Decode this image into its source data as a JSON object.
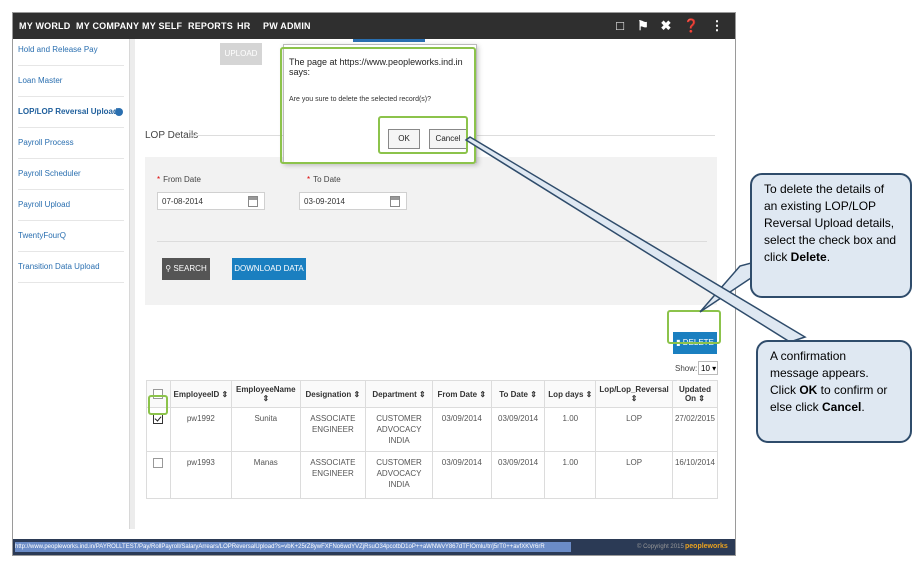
{
  "nav": {
    "items": [
      "MY WORLD",
      "MY COMPANY",
      "MY SELF",
      "REPORTS",
      "HR",
      "PW ADMIN"
    ],
    "icons": [
      "book-icon",
      "flag-icon",
      "tools-icon",
      "help-icon",
      "share-icon"
    ]
  },
  "sidebar": {
    "items": [
      {
        "label": "Hold and Release Pay"
      },
      {
        "label": "Loan Master"
      },
      {
        "label": "LOP/LOP Reversal Upload",
        "active": true
      },
      {
        "label": "Payroll Process"
      },
      {
        "label": "Payroll Scheduler"
      },
      {
        "label": "Payroll Upload"
      },
      {
        "label": "TwentyFourQ"
      },
      {
        "label": "Transition Data Upload"
      }
    ]
  },
  "main": {
    "upload_label": "UPLOAD",
    "section_title": "LOP Details",
    "from_date_label": "From Date",
    "from_date_value": "07-08-2014",
    "to_date_label": "To Date",
    "to_date_value": "03-09-2014",
    "search_label": "SEARCH",
    "download_label": "DOWNLOAD DATA",
    "delete_label": "DELETE",
    "show_label": "Show:",
    "show_value": "10"
  },
  "table": {
    "headers": [
      "EmployeeID",
      "EmployeeName",
      "Designation",
      "Department",
      "From Date",
      "To Date",
      "Lop days",
      "Lop/Lop_Reversal",
      "Updated On"
    ],
    "rows": [
      {
        "checked": true,
        "cells": [
          "pw1992",
          "Sunita",
          "ASSOCIATE ENGINEER",
          "CUSTOMER ADVOCACY INDIA",
          "03/09/2014",
          "03/09/2014",
          "1.00",
          "LOP",
          "27/02/2015"
        ]
      },
      {
        "checked": false,
        "cells": [
          "pw1993",
          "Manas",
          "ASSOCIATE ENGINEER",
          "CUSTOMER ADVOCACY INDIA",
          "03/09/2014",
          "03/09/2014",
          "1.00",
          "LOP",
          "16/10/2014"
        ]
      }
    ]
  },
  "dialog": {
    "title": "The page at https://www.peopleworks.ind.in says:",
    "message": "Are you sure to delete the selected record(s)?",
    "ok_label": "OK",
    "cancel_label": "Cancel"
  },
  "statusbar": {
    "url": "http://www.peopleworks.ind.in/PAYROLLTEST/Pay/RollPayroll/SalaryArrears/LOPReversalUpload?s=vbK+25rZ8ywFXFNo6wdYVZjRsuO34pcotbD1oP++aWNWvY867dTFIOmlu/tr/j5rT0++avfXKVr6rR",
    "copyright": "© Copyright 2015",
    "brand": "peopleworks"
  },
  "callouts": {
    "delete_parts": [
      "To delete the details of an existing LOP/LOP Reversal Upload details, select the check box and click ",
      "Delete",
      "."
    ],
    "confirm_parts": [
      "A confirmation message appears. Click ",
      "OK",
      " to confirm or else click ",
      "Cancel",
      "."
    ]
  }
}
